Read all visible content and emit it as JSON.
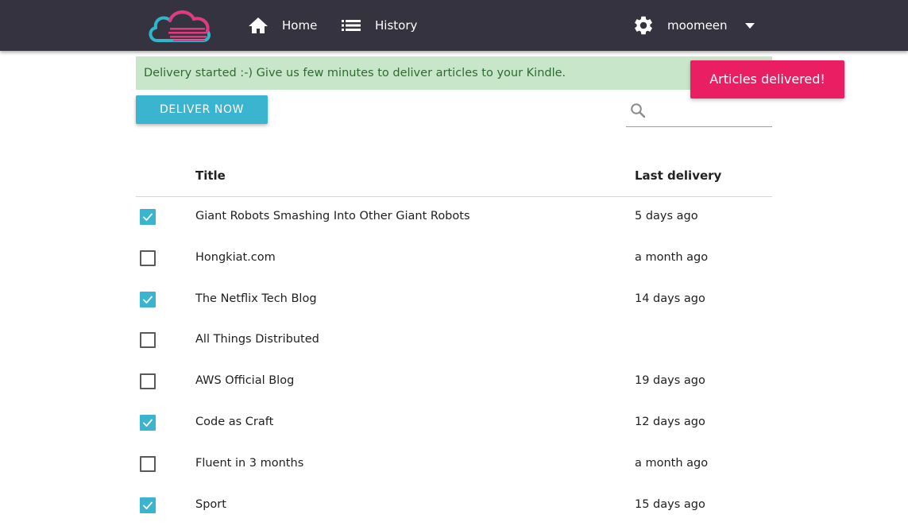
{
  "nav": {
    "home_label": "Home",
    "history_label": "History",
    "username": "moomeen"
  },
  "alert": {
    "message": "Delivery started :-) Give us few minutes to deliver articles to your Kindle."
  },
  "toast": {
    "message": "Articles delivered!"
  },
  "actions": {
    "deliver_label": "DELIVER NOW"
  },
  "search": {
    "placeholder": "",
    "value": ""
  },
  "table": {
    "columns": [
      "Title",
      "Last delivery"
    ],
    "rows": [
      {
        "checked": true,
        "title": "Giant Robots Smashing Into Other Giant Robots",
        "last_delivery": "5 days ago"
      },
      {
        "checked": false,
        "title": "Hongkiat.com",
        "last_delivery": "a month ago"
      },
      {
        "checked": true,
        "title": "The Netflix Tech Blog",
        "last_delivery": "14 days ago"
      },
      {
        "checked": false,
        "title": "All Things Distributed",
        "last_delivery": ""
      },
      {
        "checked": false,
        "title": "AWS Official Blog",
        "last_delivery": "19 days ago"
      },
      {
        "checked": true,
        "title": "Code as Craft",
        "last_delivery": "12 days ago"
      },
      {
        "checked": false,
        "title": "Fluent in 3 months",
        "last_delivery": "a month ago"
      },
      {
        "checked": true,
        "title": "Sport",
        "last_delivery": "15 days ago"
      }
    ]
  },
  "icons": {
    "logo": "cloud-logo-icon",
    "home": "home-icon",
    "history": "list-icon",
    "settings": "gear-icon",
    "menu": "caret-down-icon",
    "search": "search-icon",
    "checkbox": "check-icon"
  },
  "colors": {
    "navbar": "#35333f",
    "accent": "#3ab4cf",
    "toast": "#e91e63",
    "alert_bg": "#c8e6c9",
    "alert_text": "#2e6b30"
  }
}
